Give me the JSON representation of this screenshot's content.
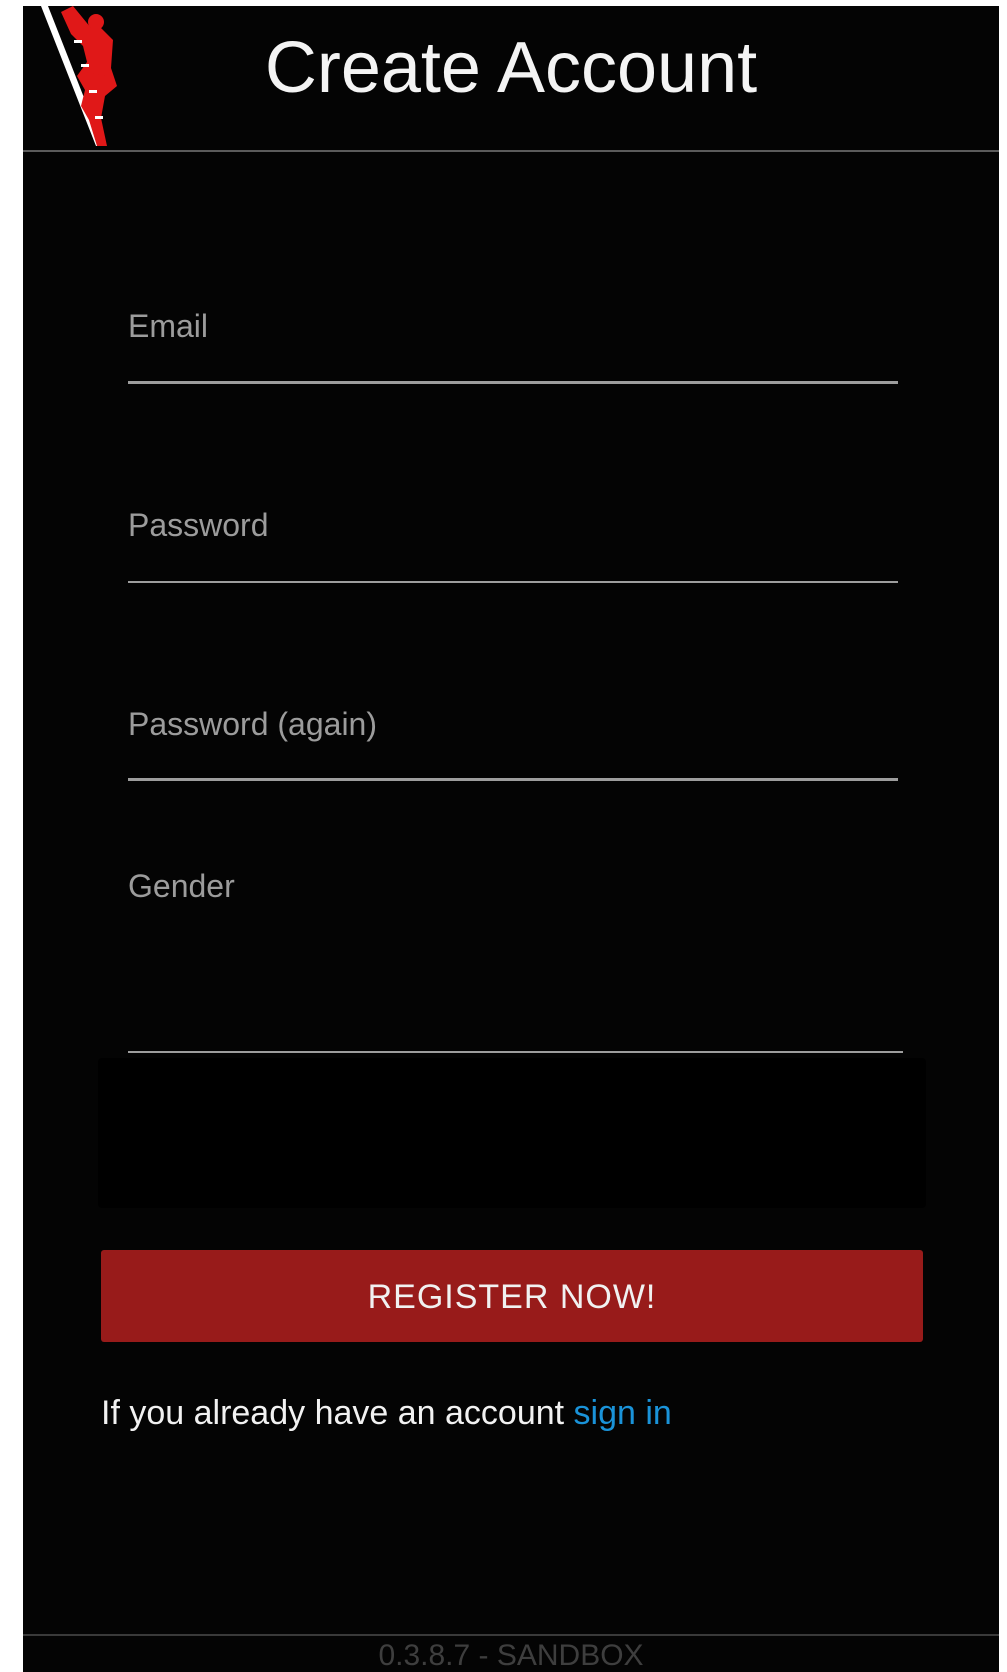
{
  "header": {
    "title": "Create Account",
    "logo_icon": "climber-ladder-logo-icon",
    "accent_color": "#e01818"
  },
  "form": {
    "email": {
      "label": "Email",
      "value": ""
    },
    "password": {
      "label": "Password",
      "value": ""
    },
    "password_again": {
      "label": "Password (again)",
      "value": ""
    },
    "gender": {
      "label": "Gender",
      "value": ""
    }
  },
  "actions": {
    "register_label": "REGISTER NOW!",
    "register_color": "#981b1a"
  },
  "signin": {
    "prefix": "If you already have an account ",
    "link_label": "sign in",
    "link_color": "#1a93d9"
  },
  "footer": {
    "version": "0.3.8.7 - SANDBOX"
  }
}
